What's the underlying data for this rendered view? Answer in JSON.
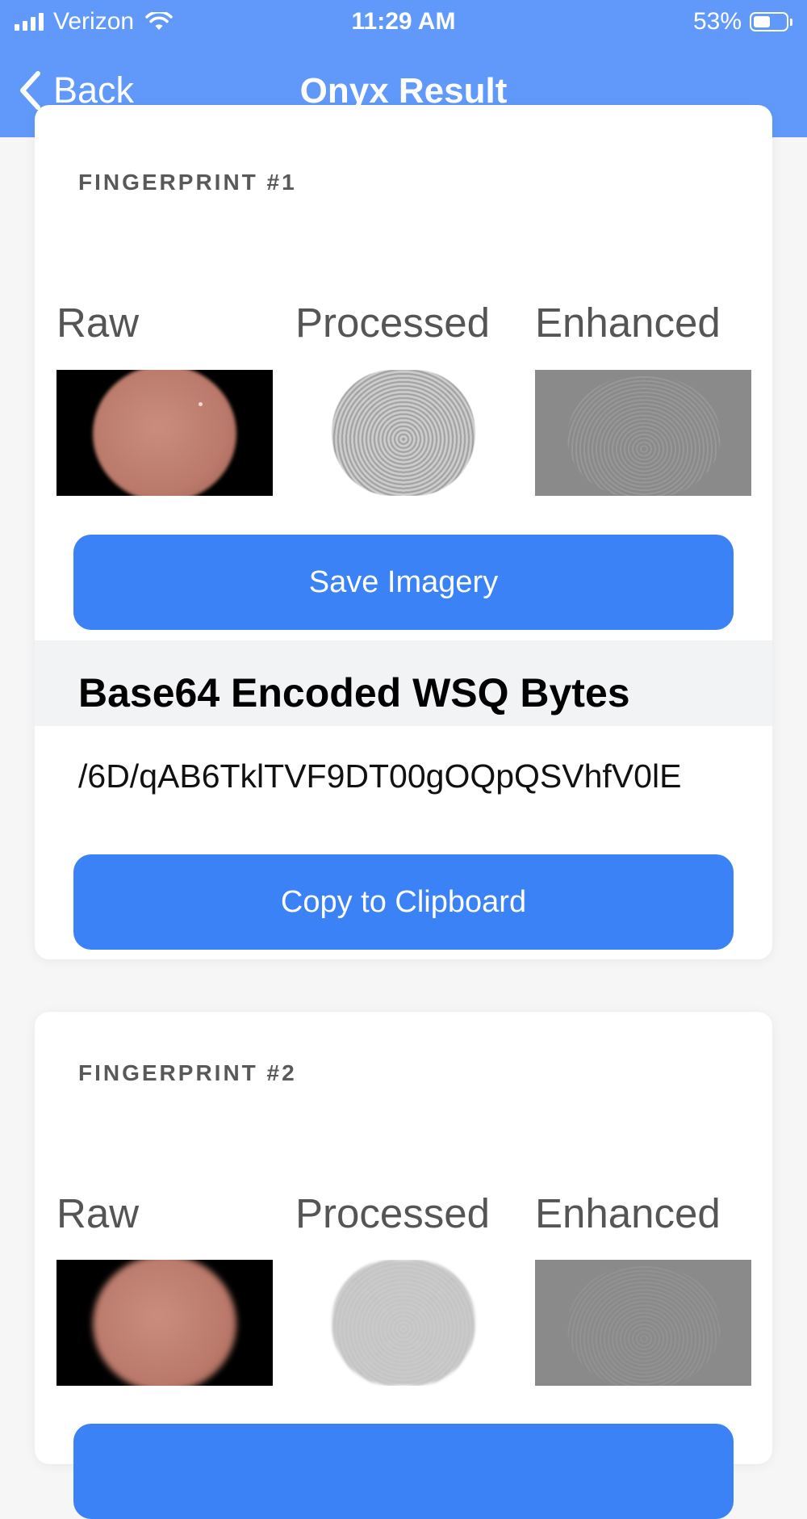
{
  "status_bar": {
    "carrier": "Verizon",
    "time": "11:29 AM",
    "battery": "53%",
    "battery_level": 0.53
  },
  "nav": {
    "back_label": "Back",
    "title": "Onyx Result"
  },
  "cards": [
    {
      "label": "FINGERPRINT #1",
      "images": {
        "raw": "Raw",
        "processed": "Processed",
        "enhanced": "Enhanced"
      },
      "save_button": "Save Imagery",
      "section_title": "Base64 Encoded WSQ Bytes",
      "encoded_bytes": "/6D/qAB6TklTVF9DT00gOQpQSVhfV0lE",
      "copy_button": "Copy to Clipboard"
    },
    {
      "label": "FINGERPRINT #2",
      "images": {
        "raw": "Raw",
        "processed": "Processed",
        "enhanced": "Enhanced"
      }
    }
  ],
  "colors": {
    "header": "#6199fa",
    "button": "#3b82f6"
  },
  "icons": [
    "signal-icon",
    "wifi-icon",
    "battery-icon",
    "chevron-left-icon"
  ]
}
